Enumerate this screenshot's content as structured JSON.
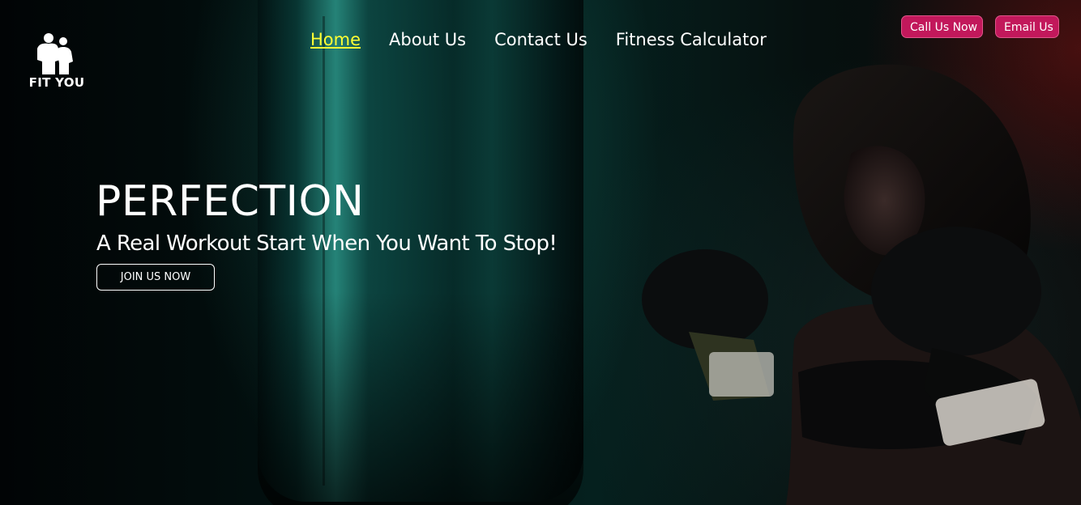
{
  "logo": {
    "icon": "two-athletes-icon",
    "label": "FIT YOU"
  },
  "nav": {
    "items": [
      {
        "label": "Home",
        "active": true
      },
      {
        "label": "About Us",
        "active": false
      },
      {
        "label": "Contact Us",
        "active": false
      },
      {
        "label": "Fitness Calculator",
        "active": false
      }
    ]
  },
  "contact": {
    "call_label": "Call Us Now",
    "email_label": "Email Us"
  },
  "hero": {
    "headline": "PERFECTION",
    "tagline": "A Real Workout Start When You Want To Stop!",
    "cta_label": "JOIN US NOW"
  },
  "colors": {
    "accent": "#c2185b",
    "active_nav": "#ffff33",
    "text": "#ffffff"
  }
}
